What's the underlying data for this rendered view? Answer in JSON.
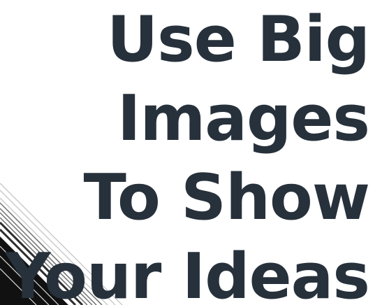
{
  "slide": {
    "headline_lines": [
      "Use Big",
      "Images",
      "To Show",
      "Your Ideas"
    ],
    "text_color": "#27313b",
    "background_color": "#ffffff",
    "decoration": "diagonal-line-photo-corner"
  }
}
